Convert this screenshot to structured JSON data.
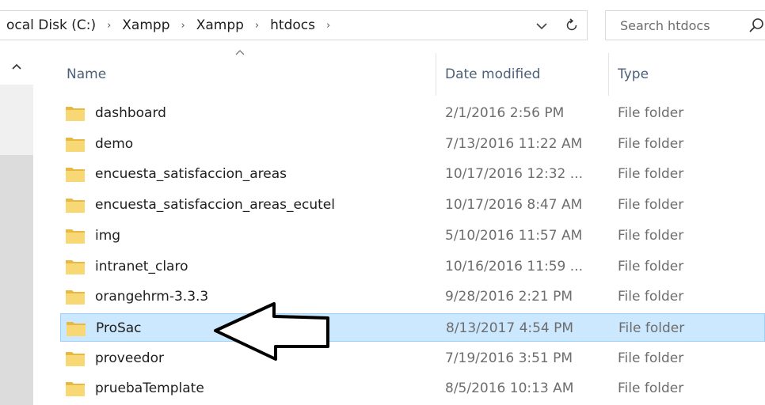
{
  "address": {
    "crumbs": [
      "ocal Disk (C:)",
      "Xampp",
      "Xampp",
      "htdocs"
    ],
    "separator": "›",
    "dropdown_icon": "chevron-down-icon",
    "refresh_icon": "refresh-icon"
  },
  "search": {
    "placeholder": "Search htdocs",
    "icon": "search-icon"
  },
  "columns": {
    "name": "Name",
    "date_modified": "Date modified",
    "type": "Type",
    "sort_indicator": "^"
  },
  "nav": {
    "scroll_up": "^"
  },
  "files": [
    {
      "name": "dashboard",
      "date": "2/1/2016 2:56 PM",
      "type": "File folder",
      "selected": false
    },
    {
      "name": "demo",
      "date": "7/13/2016 11:22 AM",
      "type": "File folder",
      "selected": false
    },
    {
      "name": "encuesta_satisfaccion_areas",
      "date": "10/17/2016 12:32 ...",
      "type": "File folder",
      "selected": false
    },
    {
      "name": "encuesta_satisfaccion_areas_ecutel",
      "date": "10/17/2016 8:47 AM",
      "type": "File folder",
      "selected": false
    },
    {
      "name": "img",
      "date": "5/10/2016 11:57 AM",
      "type": "File folder",
      "selected": false
    },
    {
      "name": "intranet_claro",
      "date": "10/16/2016 11:59 ...",
      "type": "File folder",
      "selected": false
    },
    {
      "name": "orangehrm-3.3.3",
      "date": "9/28/2016 2:21 PM",
      "type": "File folder",
      "selected": false
    },
    {
      "name": "ProSac",
      "date": "8/13/2017 4:54 PM",
      "type": "File folder",
      "selected": true
    },
    {
      "name": "proveedor",
      "date": "7/19/2016 3:51 PM",
      "type": "File folder",
      "selected": false
    },
    {
      "name": "pruebaTemplate",
      "date": "8/5/2016 10:13 AM",
      "type": "File folder",
      "selected": false
    }
  ],
  "colors": {
    "selection_bg": "#cce8ff",
    "selection_border": "#99d1ff",
    "folder": "#f8d775",
    "header_text": "#4c607a"
  }
}
